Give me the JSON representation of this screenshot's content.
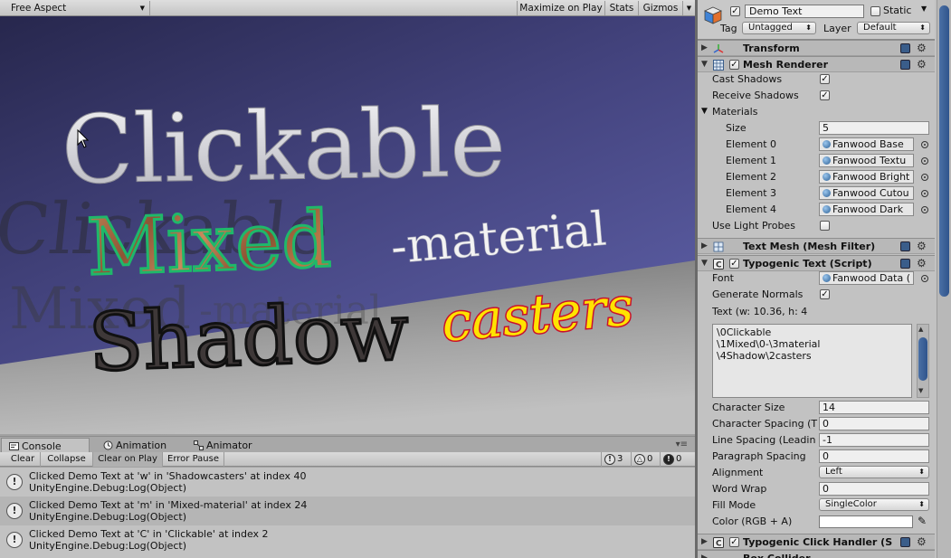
{
  "game_view": {
    "aspect": "Free Aspect",
    "buttons": {
      "maximize": "Maximize on Play",
      "stats": "Stats",
      "gizmos": "Gizmos"
    },
    "scene_text": {
      "line1": "Clickable",
      "line2_a": "Mixed",
      "line2_b": "-material",
      "line3_a": "Shadow",
      "line3_b": "casters"
    },
    "colors": {
      "sky_top": "#2a2a52",
      "sky_bottom": "#5a5ca0",
      "floor": "#8e8e8e",
      "casters_fill": "#ffe300",
      "casters_stroke": "#c8102e",
      "mixed_stroke": "#1fb86a"
    }
  },
  "console": {
    "tabs": {
      "console": "Console",
      "animation": "Animation",
      "animator": "Animator"
    },
    "toolbar": {
      "clear": "Clear",
      "collapse": "Collapse",
      "clear_on_play": "Clear on Play",
      "error_pause": "Error Pause"
    },
    "counts": {
      "info": "3",
      "warning": "0",
      "error": "0"
    },
    "entries": [
      {
        "line1": "Clicked Demo Text at 'w' in 'Shadowcasters' at index 40",
        "line2": "UnityEngine.Debug:Log(Object)"
      },
      {
        "line1": "Clicked Demo Text at 'm' in 'Mixed-material' at index 24",
        "line2": "UnityEngine.Debug:Log(Object)"
      },
      {
        "line1": "Clicked Demo Text at 'C' in 'Clickable' at index 2",
        "line2": "UnityEngine.Debug:Log(Object)"
      }
    ]
  },
  "inspector": {
    "object_name": "Demo Text",
    "static_label": "Static",
    "tag_label": "Tag",
    "tag_value": "Untagged",
    "layer_label": "Layer",
    "layer_value": "Default",
    "transform": {
      "title": "Transform"
    },
    "mesh_renderer": {
      "title": "Mesh Renderer",
      "cast_shadows": "Cast Shadows",
      "receive_shadows": "Receive Shadows",
      "materials": "Materials",
      "size_label": "Size",
      "size_value": "5",
      "elements": [
        {
          "label": "Element 0",
          "value": "Fanwood Base"
        },
        {
          "label": "Element 1",
          "value": "Fanwood Textu"
        },
        {
          "label": "Element 2",
          "value": "Fanwood Bright"
        },
        {
          "label": "Element 3",
          "value": "Fanwood Cutou"
        },
        {
          "label": "Element 4",
          "value": "Fanwood Dark"
        }
      ],
      "use_light_probes": "Use Light Probes"
    },
    "text_mesh": {
      "title": "Text Mesh (Mesh Filter)"
    },
    "typogenic_text": {
      "title": "Typogenic Text (Script)",
      "font_label": "Font",
      "font_value": "Fanwood Data (",
      "generate_normals": "Generate Normals",
      "text_label": "Text (w: 10.36, h: 4",
      "text_lines": [
        "\\0Clickable",
        "\\1Mixed\\0-\\3material",
        "\\4Shadow\\2casters"
      ],
      "char_size_label": "Character Size",
      "char_size_value": "14",
      "char_spacing_label": "Character Spacing (T",
      "char_spacing_value": "0",
      "line_spacing_label": "Line Spacing (Leadin",
      "line_spacing_value": "-1",
      "para_spacing_label": "Paragraph Spacing",
      "para_spacing_value": "0",
      "alignment_label": "Alignment",
      "alignment_value": "Left",
      "word_wrap_label": "Word Wrap",
      "word_wrap_value": "0",
      "fill_mode_label": "Fill Mode",
      "fill_mode_value": "SingleColor",
      "color_label": "Color (RGB + A)"
    },
    "click_handler": {
      "title": "Typogenic Click Handler (S"
    },
    "box_collider": {
      "title": "Box Collider"
    }
  }
}
